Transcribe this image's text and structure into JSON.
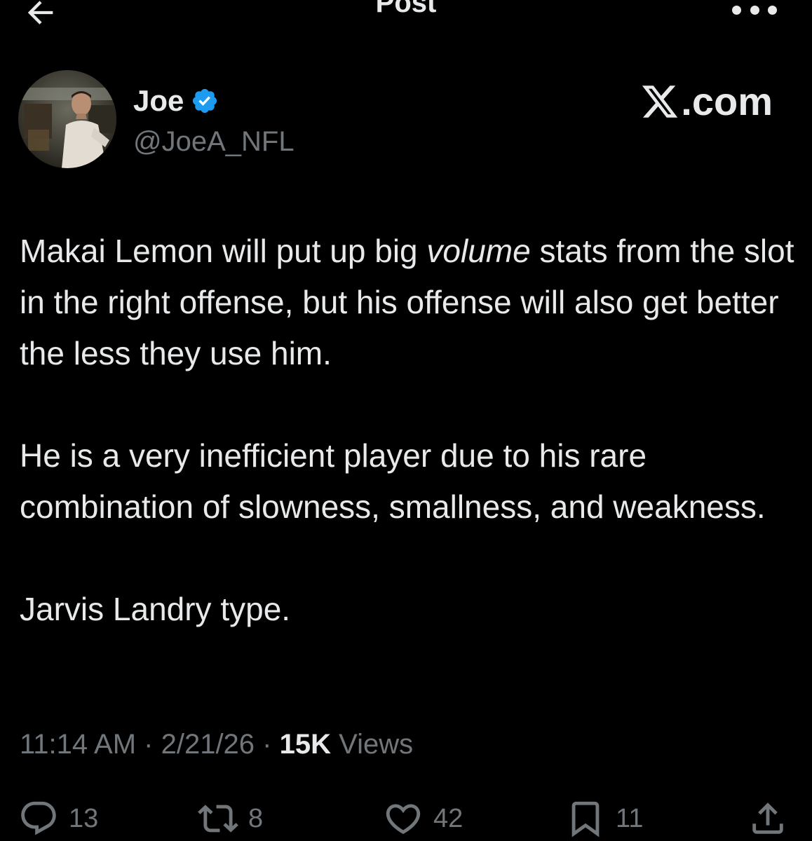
{
  "header": {
    "title": "Post",
    "back_icon": "arrow-left-icon",
    "more_icon": "more-horizontal-icon"
  },
  "author": {
    "display_name": "Joe",
    "handle": "@JoeA_NFL",
    "verified": true,
    "verified_color": "#1d9bf0"
  },
  "watermark": {
    "text": ".com"
  },
  "tweet": {
    "p1_before": "Makai Lemon will put up big ",
    "p1_em": "volume",
    "p1_after": " stats from the slot in the right offense, but his offense will also get better the less they use him.",
    "p2": "He is a very inefficient player due to his rare combination of slowness, smallness, and weakness.",
    "p3": "Jarvis Landry type."
  },
  "meta": {
    "time": "11:14 AM",
    "separator": " · ",
    "date": "2/21/26",
    "views_count": "15K",
    "views_label": " Views"
  },
  "actions": {
    "replies": "13",
    "reposts": "8",
    "likes": "42",
    "bookmarks": "11"
  },
  "colors": {
    "background": "#000000",
    "text": "#e7e9ea",
    "secondary": "#71767b",
    "accent": "#1d9bf0"
  }
}
